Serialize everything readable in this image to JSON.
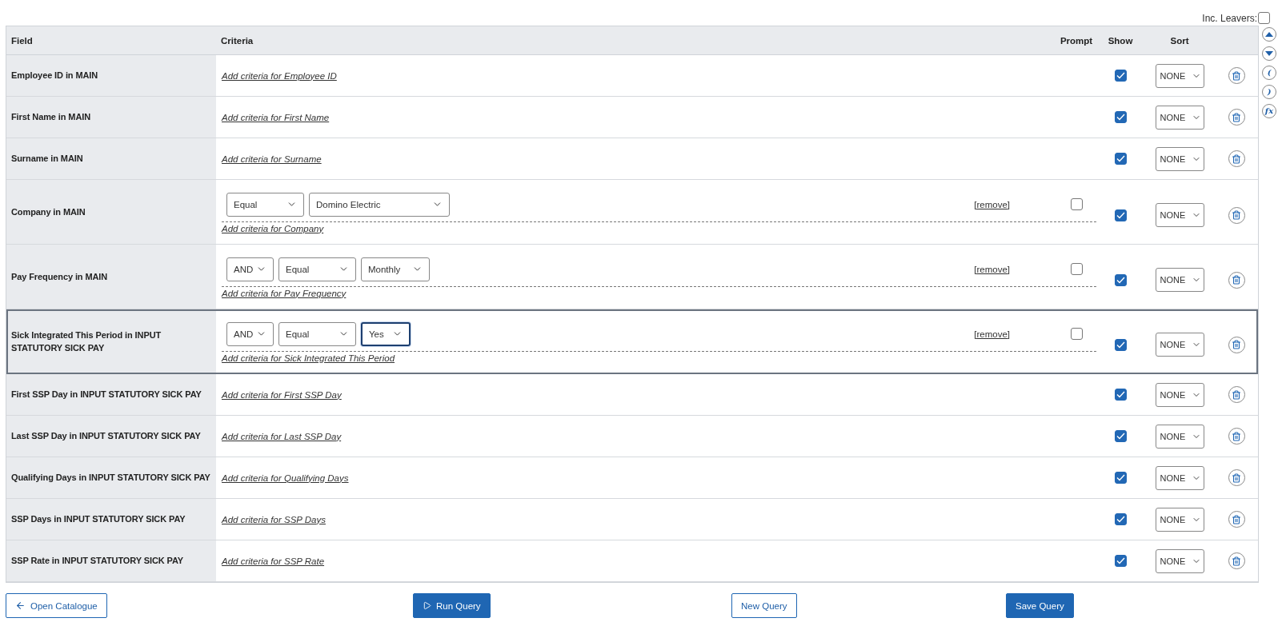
{
  "inc_leavers": {
    "label": "Inc. Leavers:",
    "checked": false
  },
  "columns": {
    "field": "Field",
    "criteria": "Criteria",
    "prompt": "Prompt",
    "show": "Show",
    "sort": "Sort"
  },
  "rows": [
    {
      "field": "Employee ID in MAIN",
      "add_link": "Add criteria for Employee ID",
      "conditions": [],
      "show": true,
      "sort": "NONE",
      "selected": false
    },
    {
      "field": "First Name in MAIN",
      "add_link": "Add criteria for First Name",
      "conditions": [],
      "show": true,
      "sort": "NONE",
      "selected": false
    },
    {
      "field": "Surname in MAIN",
      "add_link": "Add criteria for Surname",
      "conditions": [],
      "show": true,
      "sort": "NONE",
      "selected": false
    },
    {
      "field": "Company in MAIN",
      "add_link": "Add criteria for Company",
      "conditions": [
        {
          "operator": "Equal",
          "value": "Domino Electric",
          "value_focused": false,
          "remove": "[remove]",
          "prompt": false
        }
      ],
      "show": true,
      "sort": "NONE",
      "selected": false
    },
    {
      "field": "Pay Frequency in MAIN",
      "add_link": "Add criteria for Pay Frequency",
      "conditions": [
        {
          "conjunction": "AND",
          "operator": "Equal",
          "value": "Monthly",
          "value_focused": false,
          "remove": "[remove]",
          "prompt": false
        }
      ],
      "show": true,
      "sort": "NONE",
      "selected": false
    },
    {
      "field": "Sick Integrated This Period in INPUT STATUTORY SICK PAY",
      "add_link": "Add criteria for Sick Integrated This Period",
      "conditions": [
        {
          "conjunction": "AND",
          "operator": "Equal",
          "value": "Yes",
          "value_focused": true,
          "remove": "[remove]",
          "prompt": false
        }
      ],
      "show": true,
      "sort": "NONE",
      "selected": true
    },
    {
      "field": "First SSP Day in INPUT STATUTORY SICK PAY",
      "add_link": "Add criteria for First SSP Day",
      "conditions": [],
      "show": true,
      "sort": "NONE",
      "selected": false
    },
    {
      "field": "Last SSP Day in INPUT STATUTORY SICK PAY",
      "add_link": "Add criteria for Last SSP Day",
      "conditions": [],
      "show": true,
      "sort": "NONE",
      "selected": false
    },
    {
      "field": "Qualifying Days in INPUT STATUTORY SICK PAY",
      "add_link": "Add criteria for Qualifying Days",
      "conditions": [],
      "show": true,
      "sort": "NONE",
      "selected": false
    },
    {
      "field": "SSP Days in INPUT STATUTORY SICK PAY",
      "add_link": "Add criteria for SSP Days",
      "conditions": [],
      "show": true,
      "sort": "NONE",
      "selected": false
    },
    {
      "field": "SSP Rate in INPUT STATUTORY SICK PAY",
      "add_link": "Add criteria for SSP Rate",
      "conditions": [],
      "show": true,
      "sort": "NONE",
      "selected": false
    }
  ],
  "side_tools": [
    {
      "kind": "up"
    },
    {
      "kind": "down"
    },
    {
      "kind": "text",
      "label": "("
    },
    {
      "kind": "text",
      "label": ")"
    },
    {
      "kind": "text",
      "label": "fx"
    }
  ],
  "buttons": [
    {
      "kind": "back",
      "label": "Open Catalogue",
      "primary": false
    },
    {
      "kind": "run",
      "label": "Run Query",
      "primary": true
    },
    {
      "kind": "plain",
      "label": "New Query",
      "primary": false
    },
    {
      "kind": "plain",
      "label": "Save Query",
      "primary": true
    }
  ]
}
